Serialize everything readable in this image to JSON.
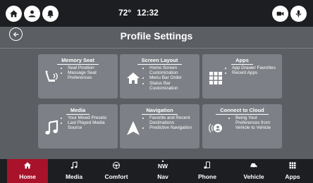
{
  "status": {
    "temperature": "72°",
    "time": "12:32"
  },
  "page": {
    "title": "Profile Settings"
  },
  "colors": {
    "accent": "#a8122a",
    "tile": "#7d8086",
    "background": "#5b5e63",
    "bar": "#1c1e21"
  },
  "tiles": [
    {
      "title": "Memory Seat",
      "icon": "seat-icon",
      "items": [
        "Seat Position",
        "Massage Seat Preferences"
      ]
    },
    {
      "title": "Screen Layout",
      "icon": "home-icon",
      "items": [
        "Home Screen Customization",
        "Menu Bar Order",
        "Status Bar Customization"
      ]
    },
    {
      "title": "Apps",
      "icon": "grid-icon",
      "items": [
        "App Drawer Favorites",
        "Recent Apps"
      ]
    },
    {
      "title": "Media",
      "icon": "music-note-icon",
      "items": [
        "Your Mixed Presets",
        "Last Played Media Source"
      ]
    },
    {
      "title": "Navigation",
      "icon": "navigation-arrow-icon",
      "items": [
        "Favorite and Recent Destinations",
        "Predictive Navigation"
      ]
    },
    {
      "title": "Connect to Cloud",
      "icon": "cloud-profile-icon",
      "text": "Being Your Preferences from Vehicle to Vehicle"
    }
  ],
  "nav": [
    {
      "label": "Home",
      "icon": "home-icon",
      "active": true
    },
    {
      "label": "Media",
      "icon": "music-note-icon"
    },
    {
      "label": "Comfort",
      "icon": "steering-wheel-icon"
    },
    {
      "label": "Nav",
      "icon": "compass-icon",
      "indicator": "NW"
    },
    {
      "label": "Phone",
      "icon": "phone-icon"
    },
    {
      "label": "Vehicle",
      "icon": "car-icon"
    },
    {
      "label": "Apps",
      "icon": "grid-icon"
    }
  ]
}
